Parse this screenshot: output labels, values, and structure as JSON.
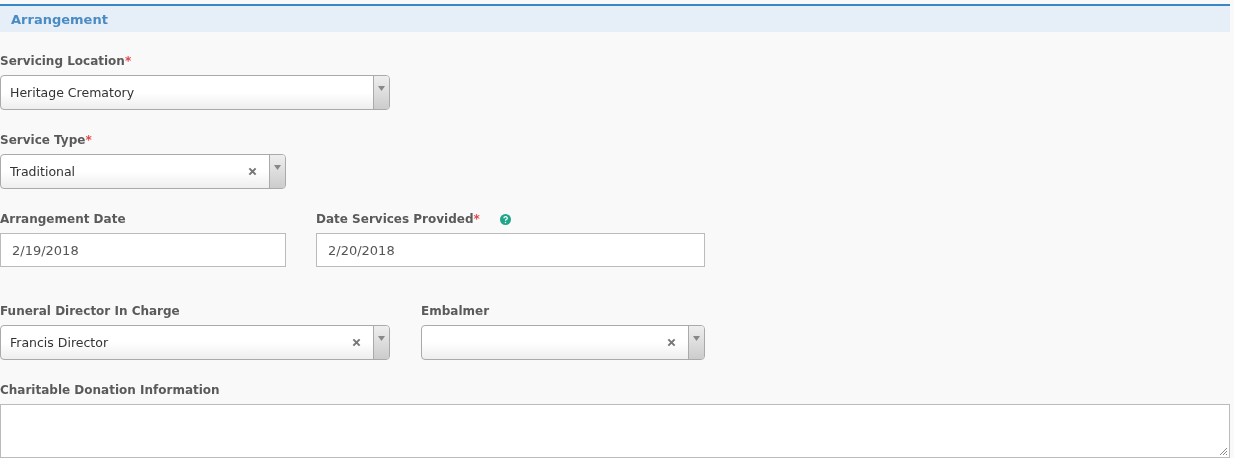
{
  "section": {
    "title": "Arrangement"
  },
  "rows": [
    {
      "fields": [
        {
          "kind": "select",
          "label": "Servicing Location",
          "required_mark": "*",
          "value": "Heritage Crematory",
          "clearable": false
        }
      ]
    },
    {
      "fields": [
        {
          "kind": "select",
          "label": "Service Type",
          "required_mark": "*",
          "value": "Traditional",
          "clearable": true
        }
      ]
    },
    {
      "fields": [
        {
          "kind": "text",
          "label": "Arrangement Date",
          "value": "2/19/2018"
        },
        {
          "kind": "text",
          "label": "Date Services Provided",
          "required_mark": "*",
          "help": true,
          "value": "2/20/2018"
        }
      ]
    },
    {
      "fields": [
        {
          "kind": "select",
          "label": "Funeral Director In Charge",
          "value": "Francis Director",
          "clearable": true
        },
        {
          "kind": "select",
          "label": "Embalmer",
          "clearable": true
        }
      ]
    },
    {
      "fields": [
        {
          "kind": "textarea",
          "label": "Charitable Donation Information"
        }
      ]
    }
  ]
}
